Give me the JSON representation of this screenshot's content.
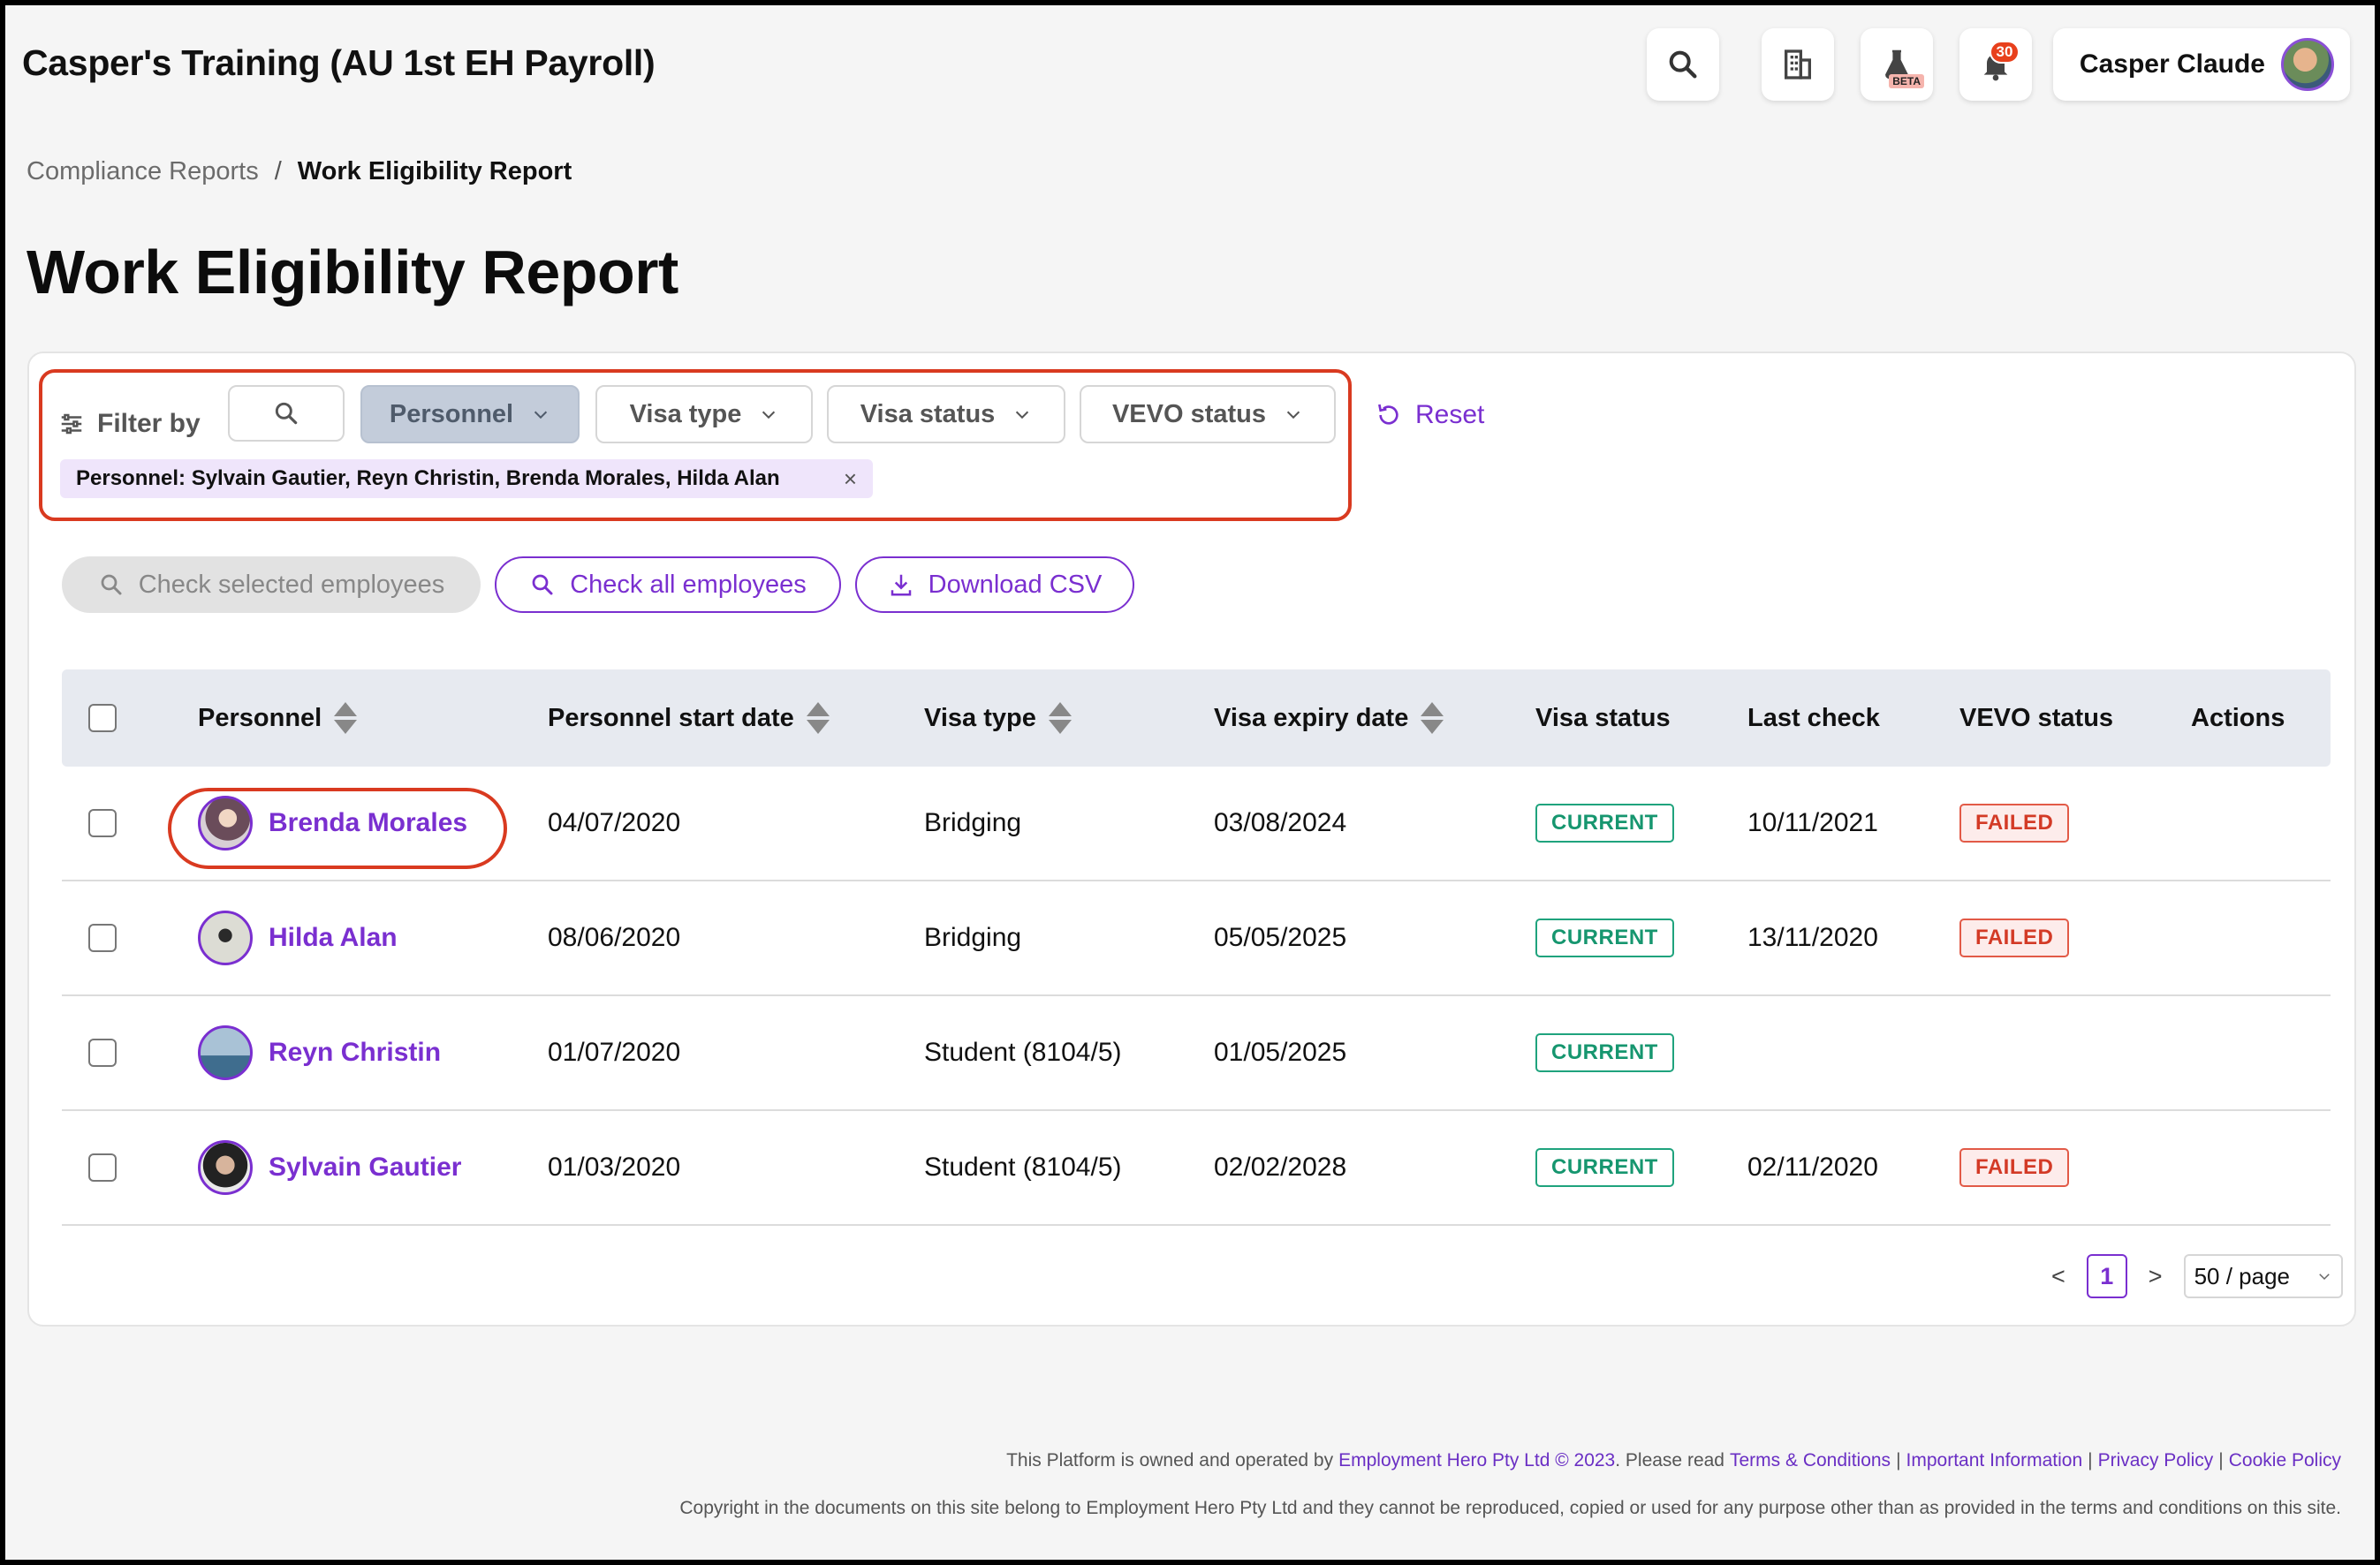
{
  "header": {
    "app_title": "Casper's Training (AU 1st EH Payroll)",
    "beta_badge": "BETA",
    "notification_count": "30",
    "user_name": "Casper Claude"
  },
  "breadcrumb": {
    "parent": "Compliance Reports",
    "separator": "/",
    "current": "Work Eligibility Report"
  },
  "page_title": "Work Eligibility Report",
  "filters": {
    "label": "Filter by",
    "dropdowns": [
      "Personnel",
      "Visa type",
      "Visa status",
      "VEVO status"
    ],
    "reset_label": "Reset",
    "active_tag": "Personnel: Sylvain Gautier, Reyn Christin, Brenda Morales, Hilda Alan",
    "tag_close": "×"
  },
  "actions": {
    "check_selected": "Check selected employees",
    "check_all": "Check all employees",
    "download_csv": "Download CSV"
  },
  "table": {
    "columns": [
      "Personnel",
      "Personnel start date",
      "Visa type",
      "Visa expiry date",
      "Visa status",
      "Last check",
      "VEVO status",
      "Actions"
    ],
    "rows": [
      {
        "name": "Brenda Morales",
        "start": "04/07/2020",
        "visa_type": "Bridging",
        "expiry": "03/08/2024",
        "visa_status": "CURRENT",
        "last_check": "10/11/2021",
        "vevo": "FAILED"
      },
      {
        "name": "Hilda Alan",
        "start": "08/06/2020",
        "visa_type": "Bridging",
        "expiry": "05/05/2025",
        "visa_status": "CURRENT",
        "last_check": "13/11/2020",
        "vevo": "FAILED"
      },
      {
        "name": "Reyn Christin",
        "start": "01/07/2020",
        "visa_type": "Student (8104/5)",
        "expiry": "01/05/2025",
        "visa_status": "CURRENT",
        "last_check": "",
        "vevo": ""
      },
      {
        "name": "Sylvain Gautier",
        "start": "01/03/2020",
        "visa_type": "Student (8104/5)",
        "expiry": "02/02/2028",
        "visa_status": "CURRENT",
        "last_check": "02/11/2020",
        "vevo": "FAILED"
      }
    ]
  },
  "pagination": {
    "prev": "<",
    "current_page": "1",
    "next": ">",
    "page_size": "50 / page"
  },
  "footer": {
    "part1": "This Platform is owned and operated by",
    "company_link": "Employment Hero Pty Ltd © 2023",
    "part2": ". Please read",
    "terms": "Terms & Conditions",
    "sep": "|",
    "important": "Important Information",
    "privacy": "Privacy Policy",
    "cookie": "Cookie Policy",
    "copyright": "Copyright in the documents on this site belong to Employment Hero Pty Ltd and they cannot be reproduced, copied or used for any purpose other than as provided in the terms and conditions on this site."
  },
  "colors": {
    "accent": "#7a2fd0",
    "highlight": "#d93a20",
    "current": "#1fa37d",
    "failed": "#d33a26"
  }
}
